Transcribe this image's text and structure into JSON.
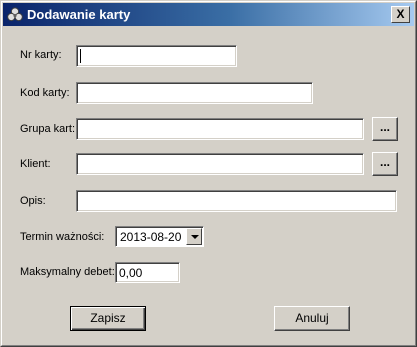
{
  "window": {
    "title": "Dodawanie karty",
    "close_label": "X",
    "title_icon": "app-clover-icon",
    "colors": {
      "title_start": "#0a246a",
      "title_end": "#a6caf0",
      "face": "#d4d0c8"
    }
  },
  "form": {
    "nr_karty": {
      "label": "Nr karty:",
      "value": ""
    },
    "kod_karty": {
      "label": "Kod karty:",
      "value": ""
    },
    "grupa_kart": {
      "label": "Grupa kart:",
      "value": "",
      "browse_label": "..."
    },
    "klient": {
      "label": "Klient:",
      "value": "",
      "browse_label": "..."
    },
    "opis": {
      "label": "Opis:",
      "value": ""
    },
    "termin_waznosci": {
      "label": "Termin ważności:",
      "value": "2013-08-20"
    },
    "maksymalny_debet": {
      "label": "Maksymalny debet:",
      "value": "0,00"
    }
  },
  "buttons": {
    "save_label": "Zapisz",
    "cancel_label": "Anuluj"
  }
}
